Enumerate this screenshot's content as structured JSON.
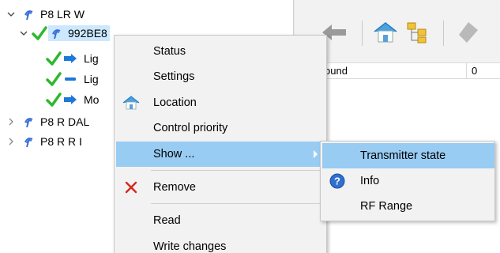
{
  "tree": {
    "nodes": [
      {
        "label": "P8 LR W",
        "expanded": true
      },
      {
        "label": "992BE8",
        "expanded": true,
        "selected": true
      },
      {
        "label": "Lig"
      },
      {
        "label": "Lig"
      },
      {
        "label": "Mo"
      },
      {
        "label": "P8 R DAL",
        "expanded": false
      },
      {
        "label": "P8 R R I",
        "expanded": false
      }
    ]
  },
  "right_pane": {
    "grid_row": {
      "col1": "ound",
      "col2": "0"
    }
  },
  "context_menu": {
    "items": {
      "status": "Status",
      "settings": "Settings",
      "location": "Location",
      "control_priority": "Control priority",
      "show": "Show ...",
      "remove": "Remove",
      "read": "Read",
      "write_changes": "Write changes"
    }
  },
  "submenu": {
    "items": {
      "transmitter_state": "Transmitter state",
      "info": "Info",
      "rf_range": "RF Range"
    }
  },
  "icons": {
    "antenna": "antenna-icon",
    "check": "check-icon",
    "arrow_right": "arrow-right-icon",
    "dash": "dash-icon",
    "house": "house-icon",
    "remove_x": "remove-x-icon",
    "info_question": "info-question-icon"
  },
  "colors": {
    "menu_bg": "#f2f2f2",
    "highlight": "#99ccf3",
    "check_green": "#2db82d",
    "arrow_blue": "#1e78d7",
    "antenna_blue": "#3a6fd8",
    "remove_red": "#d4281c"
  }
}
